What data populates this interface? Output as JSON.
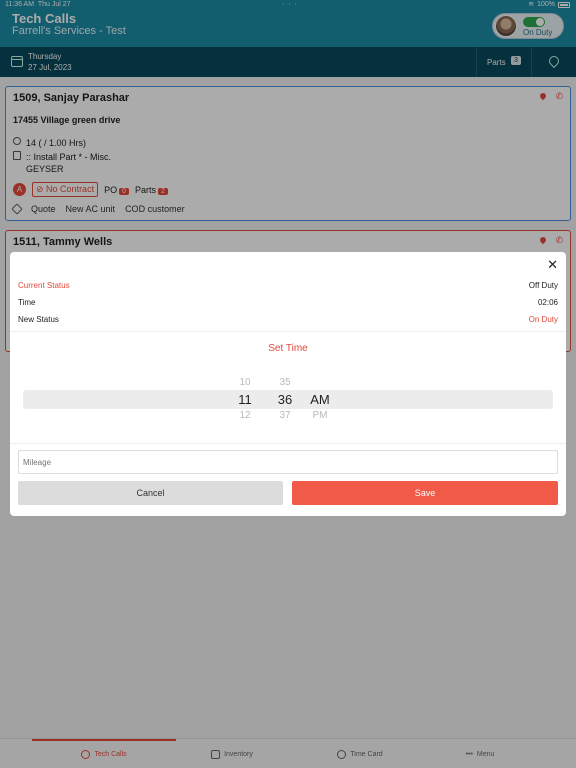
{
  "status_bar": {
    "time": "11:36 AM",
    "date": "Thu Jul 27",
    "dots": "· · ·",
    "battery": "100%"
  },
  "header": {
    "title": "Tech Calls",
    "subtitle": "Farrell's Services - Test",
    "duty_label": "On Duty",
    "duty_on": true
  },
  "date_bar": {
    "day": "Thursday",
    "date": "27 Jul, 2023",
    "parts_label": "Parts",
    "parts_count": "3"
  },
  "cards": [
    {
      "title": "1509, Sanjay Parashar",
      "address": "17455 Village green drive",
      "hours": "14 ( / 1.00 Hrs)",
      "task": ":: Install Part * - Misc.",
      "sub": "GEYSER",
      "badge": "A",
      "no_contract": "No Contract",
      "po_label": "PO",
      "po_count": "0",
      "parts_label": "Parts",
      "parts_count": "2",
      "tags": [
        "Quote",
        "New AC unit",
        "COD customer"
      ]
    },
    {
      "title": "1511, Tammy Wells"
    }
  ],
  "modal": {
    "current_status_label": "Current Status",
    "current_status_value": "Off Duty",
    "time_label": "Time",
    "time_value": "02:06",
    "new_status_label": "New Status",
    "new_status_value": "On Duty",
    "set_time": "Set Time",
    "picker": {
      "hour_prev": "10",
      "hour": "11",
      "hour_next": "12",
      "min_prev": "35",
      "min": "36",
      "min_next": "37",
      "ampm": "AM",
      "ampm_next": "PM"
    },
    "mileage_placeholder": "Mileage",
    "cancel": "Cancel",
    "save": "Save"
  },
  "tabs": [
    {
      "label": "Tech Calls",
      "active": true
    },
    {
      "label": "Inventory"
    },
    {
      "label": "Time Card"
    },
    {
      "label": "Menu"
    }
  ],
  "colors": {
    "primary": "#1c8ca6",
    "dark": "#074a5c",
    "accent": "#e5493a"
  }
}
